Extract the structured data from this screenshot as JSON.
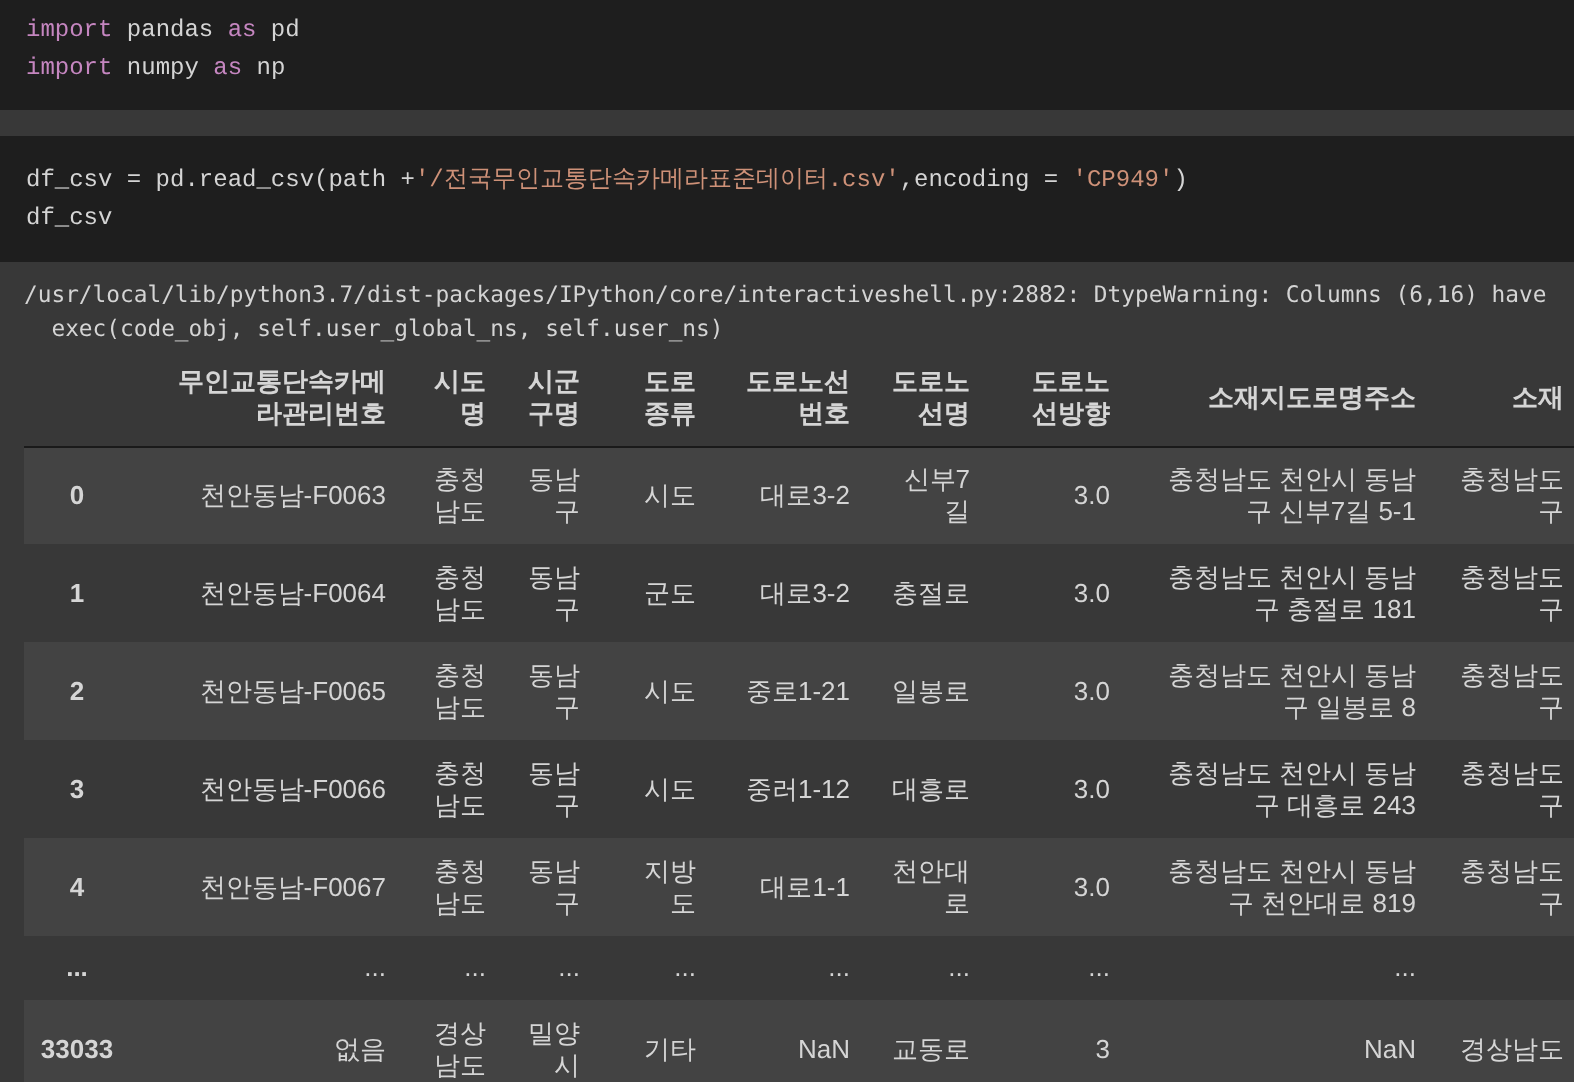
{
  "cells": [
    {
      "kind": "code",
      "lines": [
        [
          {
            "t": "import",
            "kind": "keyword"
          },
          {
            "t": " pandas "
          },
          {
            "t": "as",
            "kind": "keyword"
          },
          {
            "t": " pd"
          }
        ],
        [
          {
            "t": "import",
            "kind": "keyword"
          },
          {
            "t": " numpy "
          },
          {
            "t": "as",
            "kind": "keyword"
          },
          {
            "t": " np"
          }
        ]
      ]
    },
    {
      "kind": "code",
      "lines": [
        [
          {
            "t": "df_csv = pd.read_csv(path +"
          },
          {
            "t": "'/전국무인교통단속카메라표준데이터.csv'",
            "kind": "string"
          },
          {
            "t": ",encoding = "
          },
          {
            "t": "'CP949'",
            "kind": "string"
          },
          {
            "t": ")"
          }
        ],
        [
          {
            "t": "df_csv"
          }
        ]
      ]
    }
  ],
  "output": {
    "warning": [
      "/usr/local/lib/python3.7/dist-packages/IPython/core/interactiveshell.py:2882: DtypeWarning: Columns (6,16) have",
      "  exec(code_obj, self.user_global_ns, self.user_ns)"
    ],
    "table": {
      "columns": [
        "",
        "무인교통단속카메라관리번호",
        "시도명",
        "시군구명",
        "도로종류",
        "도로노선번호",
        "도로노선명",
        "도로노선방향",
        "소재지도로명주소",
        "소재"
      ],
      "rows": [
        {
          "kind": "data",
          "cells": [
            "0",
            "천안동남-F0063",
            "충청남도",
            "동남구",
            "시도",
            "대로3-2",
            "신부7길",
            "3.0",
            "충청남도 천안시 동남구 신부7길 5-1",
            "충청남도 구"
          ]
        },
        {
          "kind": "data",
          "cells": [
            "1",
            "천안동남-F0064",
            "충청남도",
            "동남구",
            "군도",
            "대로3-2",
            "충절로",
            "3.0",
            "충청남도 천안시 동남구 충절로 181",
            "충청남도 구"
          ]
        },
        {
          "kind": "data",
          "cells": [
            "2",
            "천안동남-F0065",
            "충청남도",
            "동남구",
            "시도",
            "중로1-21",
            "일봉로",
            "3.0",
            "충청남도 천안시 동남구 일봉로 8",
            "충청남도 구"
          ]
        },
        {
          "kind": "data",
          "cells": [
            "3",
            "천안동남-F0066",
            "충청남도",
            "동남구",
            "시도",
            "중러1-12",
            "대흥로",
            "3.0",
            "충청남도 천안시 동남구 대흥로 243",
            "충청남도 구"
          ]
        },
        {
          "kind": "data",
          "cells": [
            "4",
            "천안동남-F0067",
            "충청남도",
            "동남구",
            "지방도",
            "대로1-1",
            "천안대로",
            "3.0",
            "충청남도 천안시 동남구 천안대로 819",
            "충청남도 구"
          ]
        },
        {
          "kind": "ellipsis",
          "cells": [
            "...",
            "...",
            "...",
            "...",
            "...",
            "...",
            "...",
            "...",
            "...",
            ""
          ]
        },
        {
          "kind": "data",
          "cells": [
            "33033",
            "없음",
            "경상남도",
            "밀양시",
            "기타",
            "NaN",
            "교동로",
            "3",
            "NaN",
            "경상남도"
          ]
        }
      ]
    }
  }
}
